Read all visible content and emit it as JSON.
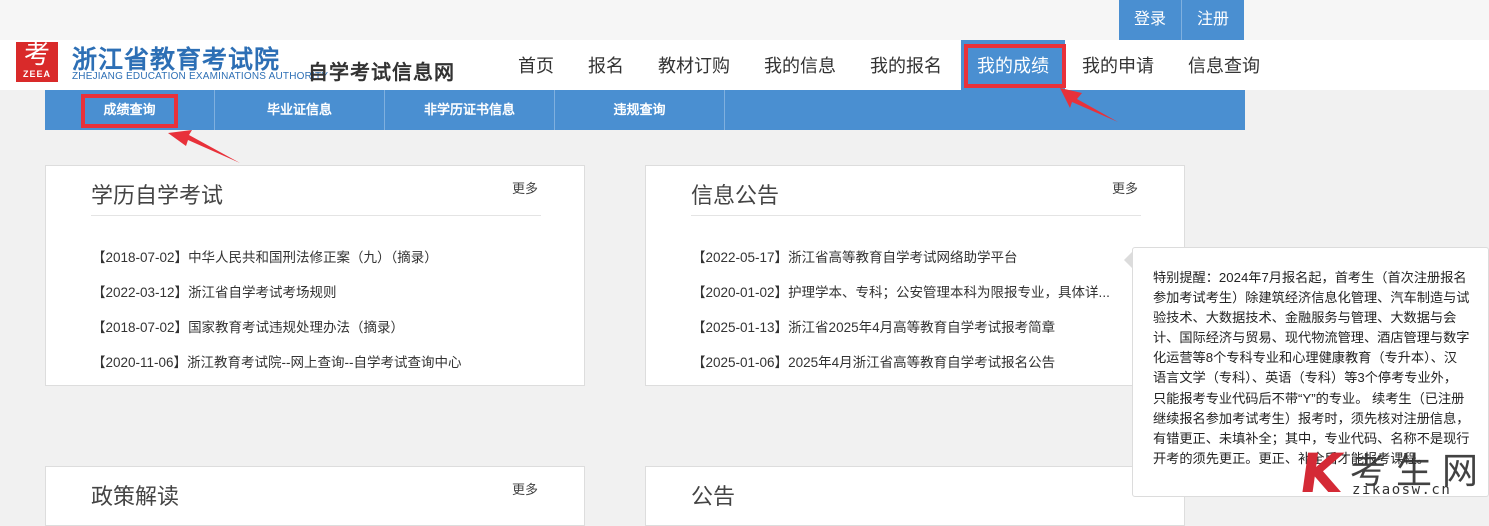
{
  "auth": {
    "login": "登录",
    "register": "注册"
  },
  "logo": {
    "mark_glyph": "考",
    "mark_abbr": "ZEEA",
    "name_cn": "浙江省教育考试院",
    "name_en": "ZHEJIANG EDUCATION EXAMINATIONS AUTHORITY",
    "site_name": "自学考试信息网"
  },
  "nav": {
    "items": [
      "首页",
      "报名",
      "教材订购",
      "我的信息",
      "我的报名",
      "我的成绩",
      "我的申请",
      "信息查询"
    ],
    "active": "我的成绩"
  },
  "subnav": {
    "items": [
      "成绩查询",
      "毕业证信息",
      "非学历证书信息",
      "违规查询"
    ]
  },
  "panels": {
    "exam": {
      "title": "学历自学考试",
      "more": "更多",
      "items": [
        {
          "date": "【2018-07-02】",
          "text": "中华人民共和国刑法修正案（九）（摘录）"
        },
        {
          "date": "【2022-03-12】",
          "text": "浙江省自学考试考场规则"
        },
        {
          "date": "【2018-07-02】",
          "text": "国家教育考试违规处理办法（摘录）"
        },
        {
          "date": "【2020-11-06】",
          "text": "浙江教育考试院--网上查询--自学考试查询中心"
        }
      ]
    },
    "info": {
      "title": "信息公告",
      "more": "更多",
      "items": [
        {
          "date": "【2022-05-17】",
          "text": "浙江省高等教育自学考试网络助学平台"
        },
        {
          "date": "【2020-01-02】",
          "text": "护理学本、专科；公安管理本科为限报专业，具体详..."
        },
        {
          "date": "【2025-01-13】",
          "text": "浙江省2025年4月高等教育自学考试报考简章"
        },
        {
          "date": "【2025-01-06】",
          "text": "2025年4月浙江省高等教育自学考试报名公告"
        }
      ]
    },
    "policy": {
      "title": "政策解读",
      "more": "更多"
    },
    "announce": {
      "title": "公告"
    }
  },
  "notice": {
    "text": "特别提醒：2024年7月报名起，首考生（首次注册报名参加考试考生）除建筑经济信息化管理、汽车制造与试验技术、大数据技术、金融服务与管理、大数据与会计、国际经济与贸易、现代物流管理、酒店管理与数字化运营等8个专科专业和心理健康教育（专升本）、汉语言文学（专科）、英语（专科）等3个停考专业外，只能报考专业代码后不带“Y”的专业。 续考生（已注册继续报名参加考试考生）报考时，须先核对注册信息，有错更正、未填补全；其中，专业代码、名称不是现行开考的须先更正。更正、补全后才能报考课程。"
  },
  "watermark": {
    "letter": "K",
    "cn": "考生网",
    "url": "zikaosw.cn"
  },
  "colors": {
    "brand_blue": "#4a8fd1",
    "highlight_red": "#e8313a",
    "logo_red": "#d92a2a"
  }
}
